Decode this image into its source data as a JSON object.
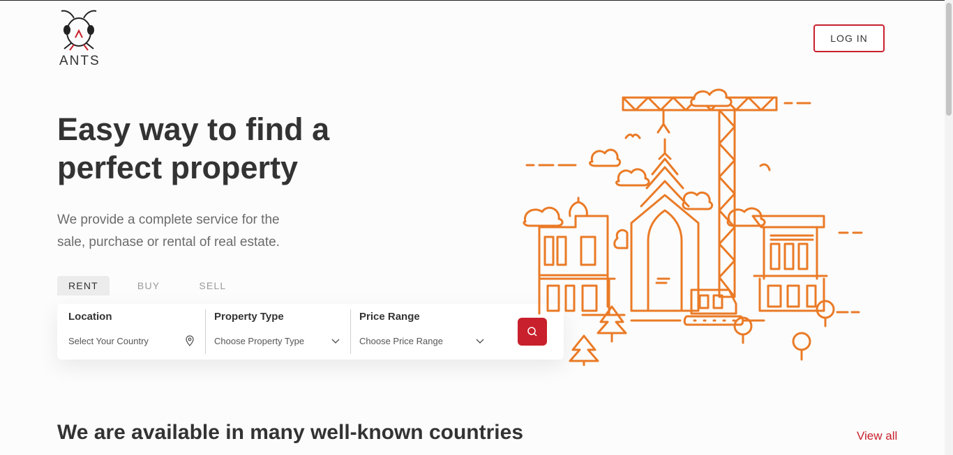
{
  "brand": {
    "name": "ANTS",
    "accent_color": "#c8202c",
    "illustration_color": "#ea7a26"
  },
  "header": {
    "login_label": "LOG IN"
  },
  "hero": {
    "title_line1": "Easy way to find a",
    "title_line2": "perfect property",
    "subtitle_line1": "We provide a complete service for the",
    "subtitle_line2": "sale, purchase or rental of real estate."
  },
  "tabs": [
    {
      "label": "RENT",
      "active": true
    },
    {
      "label": "BUY",
      "active": false
    },
    {
      "label": "SELL",
      "active": false
    }
  ],
  "search": {
    "location": {
      "label": "Location",
      "value": "Select Your Country",
      "icon": "location-pin-icon"
    },
    "property_type": {
      "label": "Property Type",
      "value": "Choose Property Type",
      "icon": "chevron-down-icon"
    },
    "price_range": {
      "label": "Price Range",
      "value": "Choose Price Range",
      "icon": "chevron-down-icon"
    },
    "button_icon": "search-icon"
  },
  "countries_section": {
    "title": "We are available in many well-known countries",
    "view_all_label": "View all"
  }
}
